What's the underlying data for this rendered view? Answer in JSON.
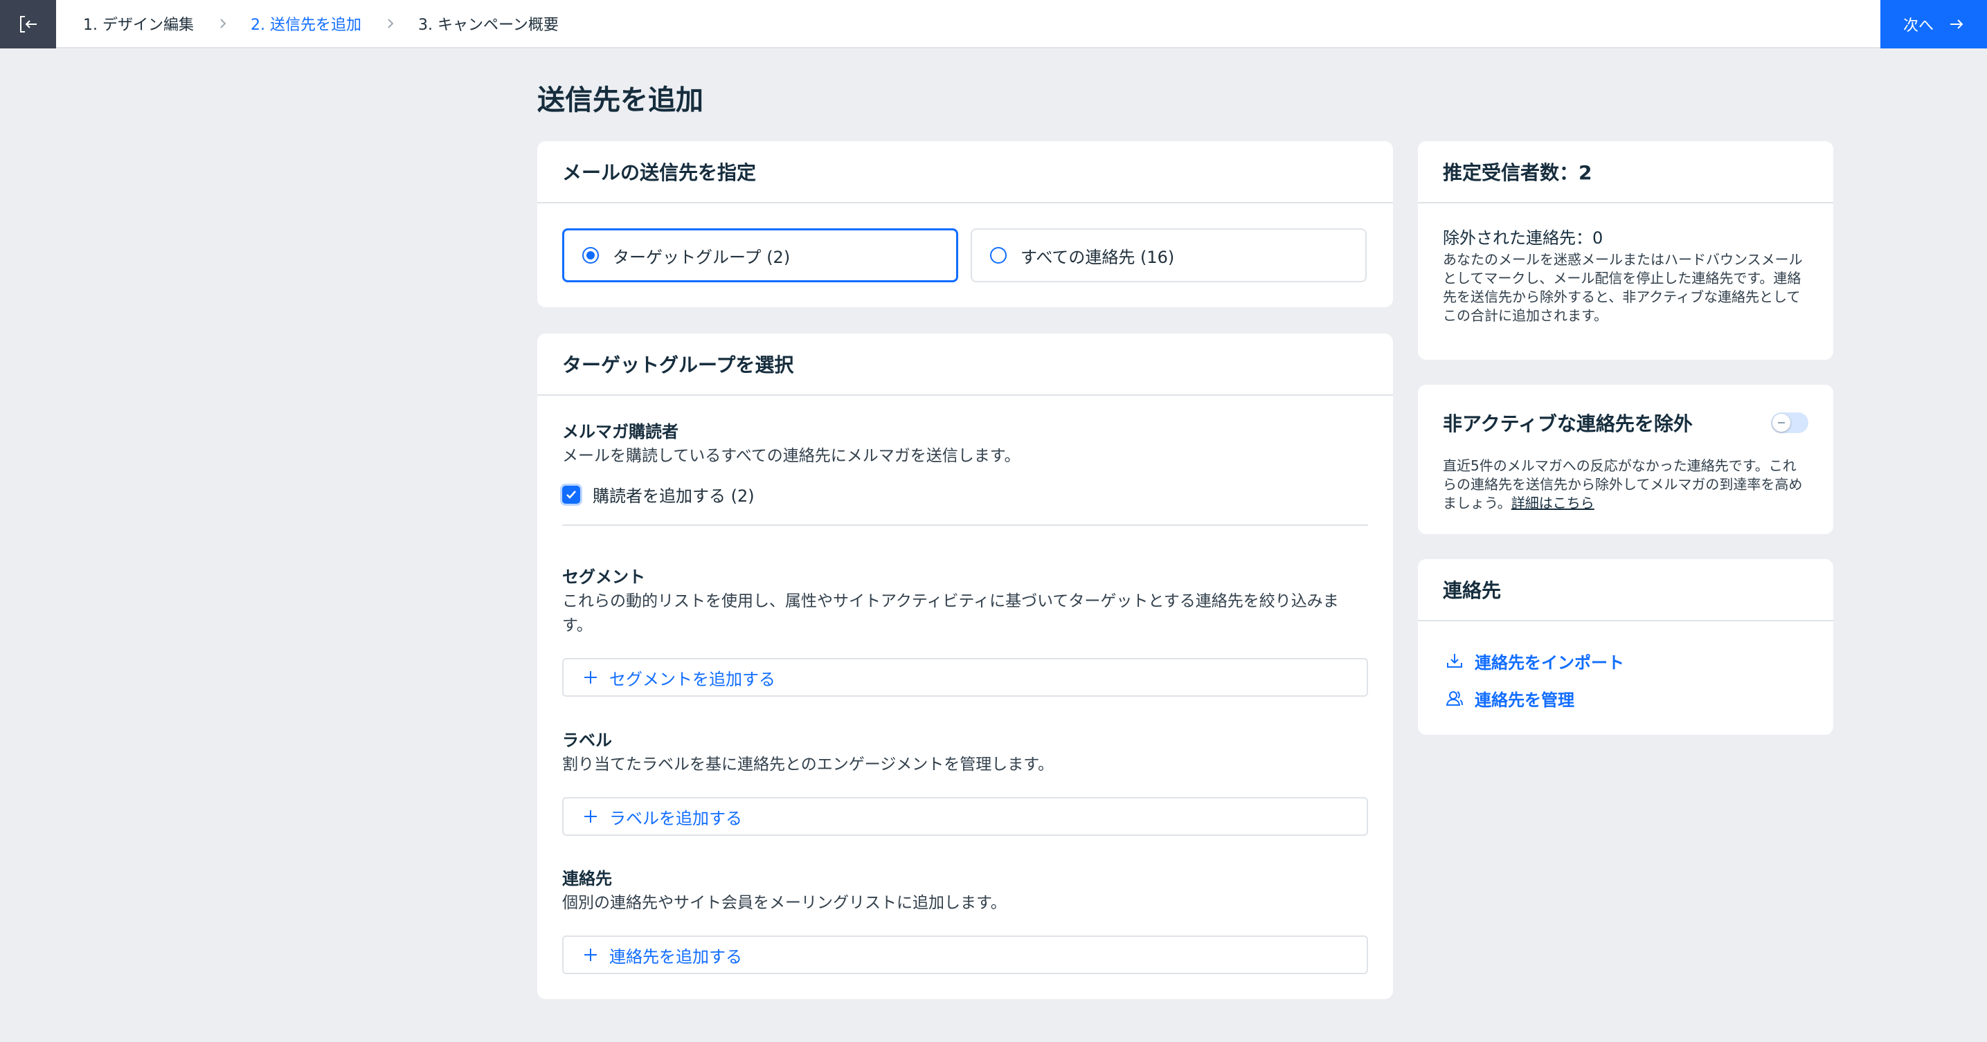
{
  "nav": {
    "exit_icon": "exit-icon",
    "steps": [
      "1. デザイン編集",
      "2. 送信先を追加",
      "3. キャンペーン概要"
    ],
    "active_step_index": 1,
    "next_label": "次へ"
  },
  "page": {
    "title": "送信先を追加"
  },
  "recipients_card": {
    "title": "メールの送信先を指定",
    "options": [
      {
        "label": "ターゲットグループ (2)",
        "selected": true
      },
      {
        "label": "すべての連絡先 (16)",
        "selected": false
      }
    ]
  },
  "target_card": {
    "title": "ターゲットグループを選択",
    "subscribers": {
      "title": "メルマガ購読者",
      "desc": "メールを購読しているすべての連絡先にメルマガを送信します。",
      "checkbox_label": "購読者を追加する (2)",
      "checked": true
    },
    "segments": {
      "title": "セグメント",
      "desc": "これらの動的リストを使用し、属性やサイトアクティビティに基づいてターゲットとする連絡先を絞り込みます。",
      "button": "セグメントを追加する"
    },
    "labels": {
      "title": "ラベル",
      "desc": "割り当てたラベルを基に連絡先とのエンゲージメントを管理します。",
      "button": "ラベルを追加する"
    },
    "contacts": {
      "title": "連絡先",
      "desc": "個別の連絡先やサイト会員をメーリングリストに追加します。",
      "button": "連絡先を追加する"
    }
  },
  "estimate_card": {
    "title": "推定受信者数：2",
    "excluded": "除外された連絡先：0",
    "note": "あなたのメールを迷惑メールまたはハードバウンスメールとしてマークし、メール配信を停止した連絡先です。連絡先を送信先から除外すると、非アクティブな連絡先としてこの合計に追加されます。"
  },
  "inactive_card": {
    "title": "非アクティブな連絡先を除外",
    "toggle_on": false,
    "desc": "直近5件のメルマガへの反応がなかった連絡先です。これらの連絡先を送信先から除外してメルマガの到達率を高めましょう。",
    "link": "詳細はこちら"
  },
  "contacts_card": {
    "title": "連絡先",
    "import_label": "連絡先をインポート",
    "manage_label": "連絡先を管理"
  },
  "colors": {
    "accent": "#116dff",
    "dark": "#3b4352",
    "background": "#eceef2"
  }
}
